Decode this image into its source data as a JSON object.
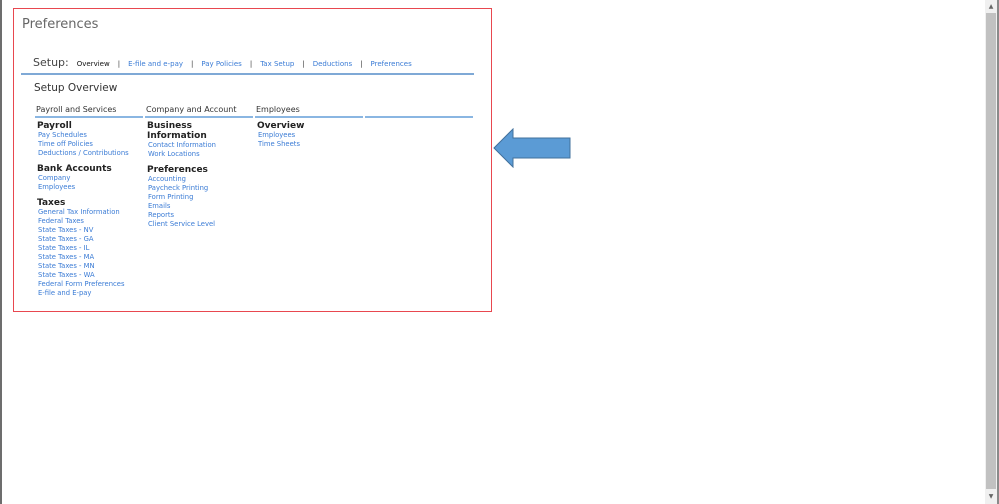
{
  "page": {
    "title": "Preferences"
  },
  "setup": {
    "label": "Setup:",
    "tabs": [
      {
        "label": "Overview"
      },
      {
        "label": "E-file and e-pay"
      },
      {
        "label": "Pay Policies"
      },
      {
        "label": "Tax Setup"
      },
      {
        "label": "Deductions"
      },
      {
        "label": "Preferences"
      }
    ],
    "separator": "|"
  },
  "overview": {
    "title": "Setup Overview",
    "columns": [
      {
        "header": "Payroll and Services",
        "sections": [
          {
            "title": "Payroll",
            "links": [
              "Pay Schedules",
              "Time off Policies",
              "Deductions / Contributions"
            ]
          },
          {
            "title": "Bank Accounts",
            "links": [
              "Company",
              "Employees"
            ]
          },
          {
            "title": "Taxes",
            "links": [
              "General Tax Information",
              "Federal Taxes",
              "State Taxes - NV",
              "State Taxes - GA",
              "State Taxes - IL",
              "State Taxes - MA",
              "State Taxes - MN",
              "State Taxes - WA",
              "Federal Form Preferences",
              "E-file and E-pay"
            ]
          }
        ]
      },
      {
        "header": "Company and Account",
        "sections": [
          {
            "title": "Business Information",
            "links": [
              "Contact Information",
              "Work Locations"
            ]
          },
          {
            "title": "Preferences",
            "links": [
              "Accounting",
              "Paycheck Printing",
              "Form Printing",
              "Emails",
              "Reports",
              "Client Service Level"
            ]
          }
        ]
      },
      {
        "header": "Employees",
        "sections": [
          {
            "title": "Overview",
            "links": [
              "Employees",
              "Time Sheets"
            ]
          }
        ]
      },
      {
        "header": "",
        "sections": []
      }
    ]
  },
  "colors": {
    "link": "#3a7bd5",
    "frame": "#e8474f",
    "underline": "#7fa9d6",
    "arrow": "#5b9bd5"
  },
  "icons": {
    "arrow": "arrow-left-icon",
    "scroll_up": "scroll-up-icon",
    "scroll_down": "scroll-down-icon"
  }
}
